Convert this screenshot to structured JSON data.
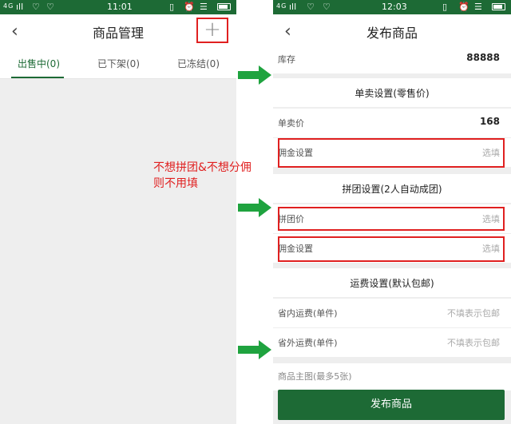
{
  "left": {
    "status": {
      "network": "4G",
      "time": "11:01"
    },
    "nav": {
      "back": "‹",
      "title": "商品管理",
      "plus": "+"
    },
    "tabs": [
      {
        "label": "出售中(0)"
      },
      {
        "label": "已下架(0)"
      },
      {
        "label": "已冻结(0)"
      }
    ]
  },
  "right": {
    "status": {
      "network": "4G",
      "time": "12:03"
    },
    "nav": {
      "back": "‹",
      "title": "发布商品"
    },
    "stock": {
      "label": "库存",
      "value": "88888"
    },
    "single": {
      "title": "单卖设置(零售价)",
      "price_label": "单卖价",
      "price_value": "168",
      "commission_label": "佣金设置",
      "commission_placeholder": "选填"
    },
    "group": {
      "title": "拼团设置(2人自动成团)",
      "price_label": "拼团价",
      "price_placeholder": "选填",
      "commission_label": "佣金设置",
      "commission_placeholder": "选填"
    },
    "shipping": {
      "title": "运费设置(默认包邮)",
      "inner_label": "省内运费(单件)",
      "inner_placeholder": "不填表示包邮",
      "outer_label": "省外运费(单件)",
      "outer_placeholder": "不填表示包邮"
    },
    "images_label": "商品主图(最多5张)",
    "submit": "发布商品"
  },
  "annotation": {
    "line1": "不想拼团&不想分佣",
    "line2": "则不用填"
  },
  "colors": {
    "brand": "#1d6a35",
    "highlight": "#e02020",
    "arrow": "#1fa33f"
  }
}
